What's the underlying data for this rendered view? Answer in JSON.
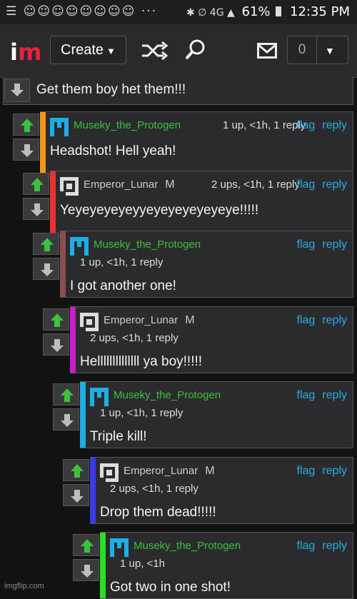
{
  "status_bar": {
    "left_icons": "☰ ☺☺☺☺☺☺☺☺ ···",
    "right_icons": "✱ ∅ 4G ▲",
    "battery": "61%",
    "time": "12:35 PM"
  },
  "navbar": {
    "create_label": "Create",
    "notifications_count": "0"
  },
  "top_comment": {
    "text": "Get them boy het them!!!"
  },
  "comments": [
    {
      "username": "Museky_the_Protogen",
      "meta": "1 up, <1h, 1 reply",
      "flag": "flag",
      "reply": "reply",
      "text": "Headshot! Hell yeah!"
    },
    {
      "username": "Emperor_Lunar",
      "badge": "M",
      "meta": "2 ups, <1h, 1 reply",
      "flag": "flag",
      "reply": "reply",
      "text": "Yeyeyeyeyeyyeyeyeyeyeyeye!!!!!"
    },
    {
      "username": "Museky_the_Protogen",
      "meta": "1 up, <1h, 1 reply",
      "flag": "flag",
      "reply": "reply",
      "text": "I got another one!"
    },
    {
      "username": "Emperor_Lunar",
      "badge": "M",
      "meta": "2 ups, <1h, 1 reply",
      "flag": "flag",
      "reply": "reply",
      "text": "Hellllllllllllll ya boy!!!!!"
    },
    {
      "username": "Museky_the_Protogen",
      "meta": "1 up, <1h, 1 reply",
      "flag": "flag",
      "reply": "reply",
      "text": "Triple kill!"
    },
    {
      "username": "Emperor_Lunar",
      "badge": "M",
      "meta": "2 ups, <1h, 1 reply",
      "flag": "flag",
      "reply": "reply",
      "text": "Drop them dead!!!!!"
    },
    {
      "username": "Museky_the_Protogen",
      "meta": "1 up, <1h",
      "flag": "flag",
      "reply": "reply",
      "text": "Got two in one shot!"
    }
  ],
  "watermark": "imgflip.com",
  "colors": {
    "username_green": "#3cc13c",
    "link_blue": "#26aee5",
    "upvote_green": "#3cc13c",
    "thread_bars": [
      "#f7941d",
      "#e83232",
      "#8a4e4e",
      "#c81ec8",
      "#1eaee5",
      "#3a3ae8",
      "#26e026"
    ]
  }
}
